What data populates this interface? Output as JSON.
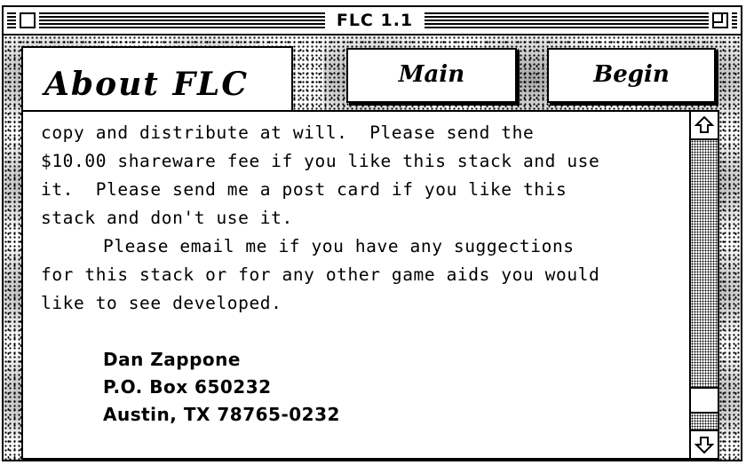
{
  "window": {
    "title": "FLC 1.1"
  },
  "header": {
    "section_title": "About FLC",
    "buttons": [
      {
        "label": "Main"
      },
      {
        "label": "Begin"
      }
    ]
  },
  "body_text": {
    "paragraph1": "copy and distribute at will.  Please send the\n$10.00 shareware fee if you like this stack and use\nit.  Please send me a post card if you like this\nstack and don't use it.",
    "paragraph2": "Please email me if you have any suggections\nfor this stack or for any other game aids you would\nlike to see developed.",
    "address": {
      "name": "Dan Zappone",
      "line1": "P.O. Box 650232",
      "line2": "Austin, TX 78765-0232"
    }
  },
  "scrollbar": {
    "position_fraction": 0.94
  },
  "icons": {
    "close": "close-box",
    "zoom": "zoom-box",
    "scroll_up": "up-arrow",
    "scroll_down": "down-arrow"
  }
}
